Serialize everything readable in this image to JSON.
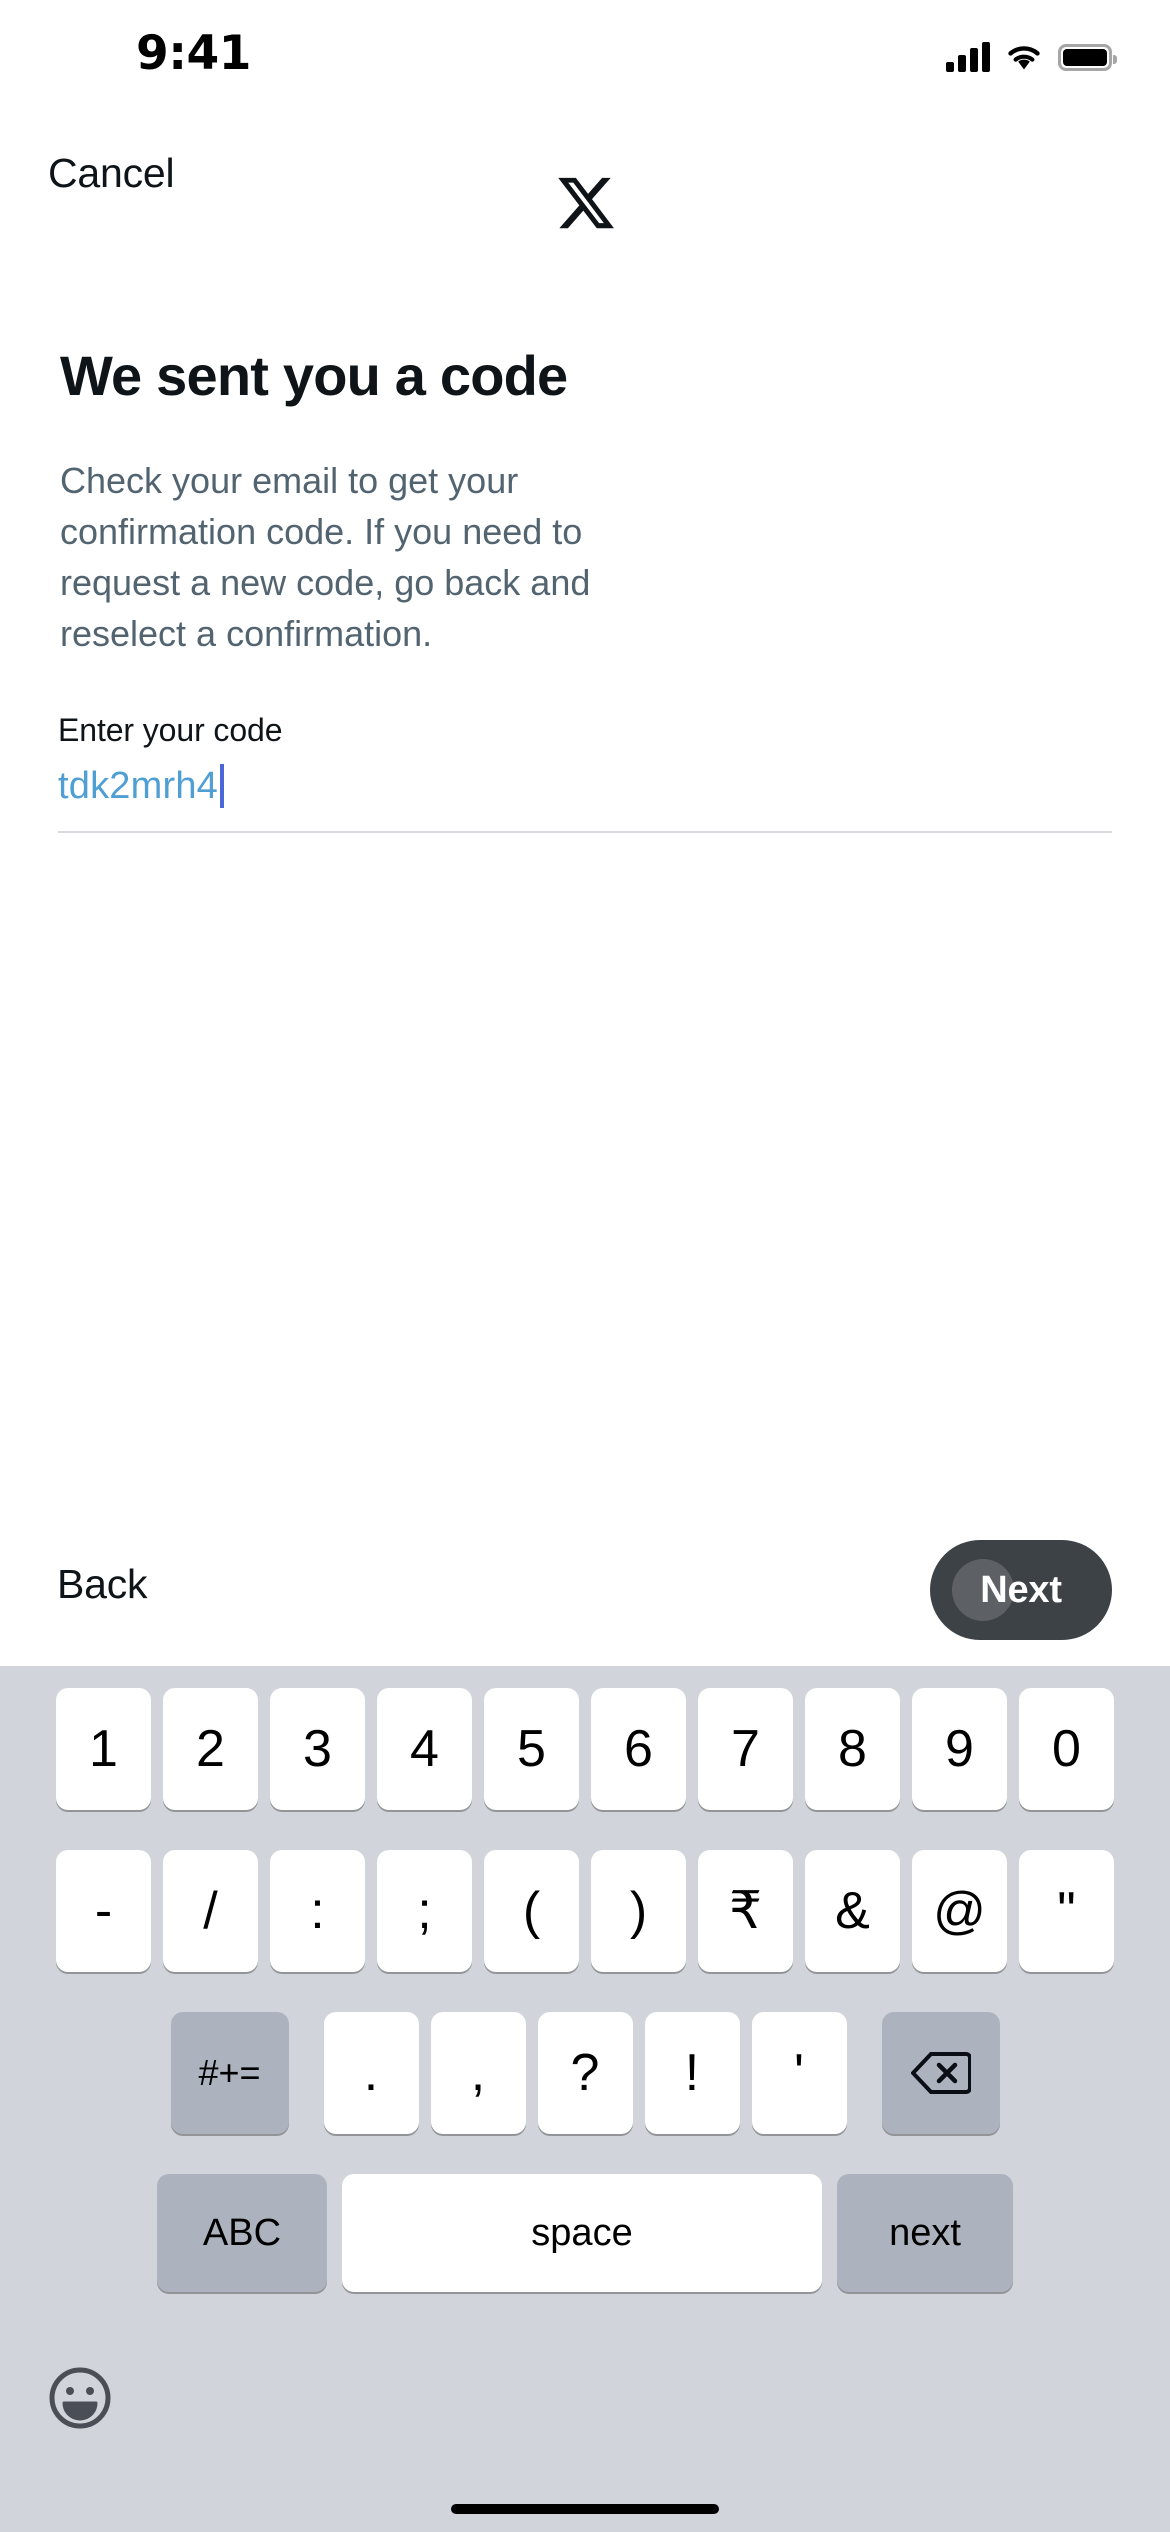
{
  "status_bar": {
    "time": "9:41",
    "signal_icon": "cellular-signal-icon",
    "wifi_icon": "wifi-icon",
    "battery_icon": "battery-full-icon"
  },
  "nav": {
    "cancel_label": "Cancel",
    "logo_icon": "x-logo-icon"
  },
  "main": {
    "headline": "We sent you a code",
    "blurb": "Check your email to get your confirmation code. If you need to request a new code, go back and reselect a confirmation.",
    "field": {
      "label": "Enter your code",
      "value": "tdk2mrh4",
      "placeholder": "",
      "value_color": "#4F9FD4",
      "caret_color": "#4B66D6",
      "underline_color": "#D7DBDF"
    }
  },
  "footer": {
    "back_label": "Back",
    "next_label": "Next",
    "next_bg": "#3D4247"
  },
  "keyboard": {
    "background": "#D1D4DA",
    "row1": [
      "1",
      "2",
      "3",
      "4",
      "5",
      "6",
      "7",
      "8",
      "9",
      "0"
    ],
    "row2": [
      "-",
      "/",
      ":",
      ";",
      "(",
      ")",
      "₹",
      "&",
      "@",
      "\""
    ],
    "row3_mod_left": "#+=",
    "row3": [
      ".",
      ",",
      "?",
      "!",
      "'"
    ],
    "row3_mod_right_icon": "backspace-icon",
    "row4": {
      "abc": "ABC",
      "space": "space",
      "next": "next"
    },
    "emoji_icon": "emoji-smiley-icon"
  }
}
